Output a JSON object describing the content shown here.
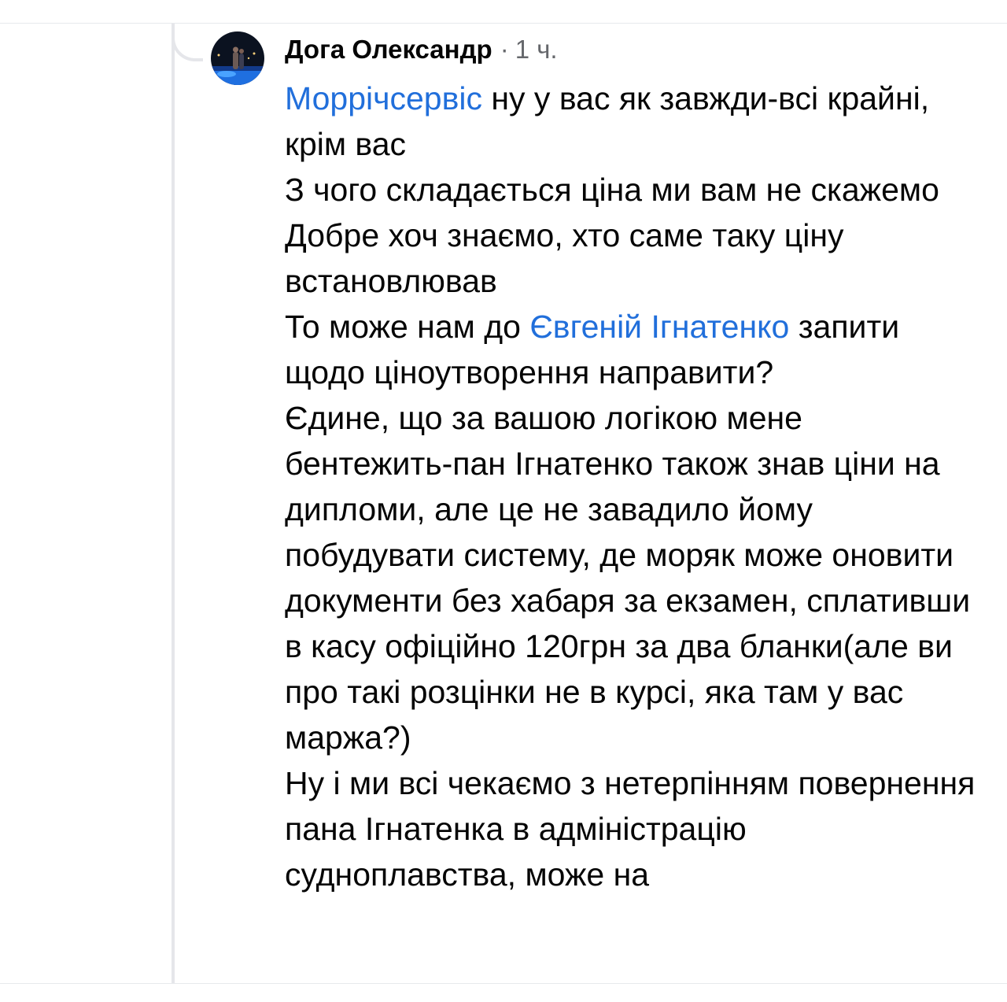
{
  "comment": {
    "author": "Дога Олександр",
    "separator": "·",
    "time": "1 ч.",
    "mention_1": "Моррічсервіс",
    "line_1_rest": " ну у вас як завжди-всі крайні, крім вас",
    "line_2": "З чого складається ціна ми вам не скажемо",
    "line_3": "Добре хоч знаємо, хто саме таку ціну встановлював",
    "line_4_start": "То може нам до ",
    "mention_2": "Євгеній Ігнатенко",
    "line_4_rest": " запити щодо ціноутворення направити?",
    "line_5": "Єдине, що за вашою логікою мене бентежить-пан Ігнатенко також знав ціни на дипломи, але це не завадило йому побудувати систему, де моряк може оновити документи без хабаря за екзамен, сплативши в касу офіційно 120грн за два бланки(але ви про такі розцінки не в курсі, яка там у вас маржа?)",
    "line_6": "Ну і ми всі чекаємо з нетерпінням повернення пана Ігнатенка в адміністрацію судноплавства, може на"
  },
  "colors": {
    "mention": "#216fdb",
    "text": "#050505",
    "secondary": "#65676b",
    "thread": "#e5e6ea"
  }
}
